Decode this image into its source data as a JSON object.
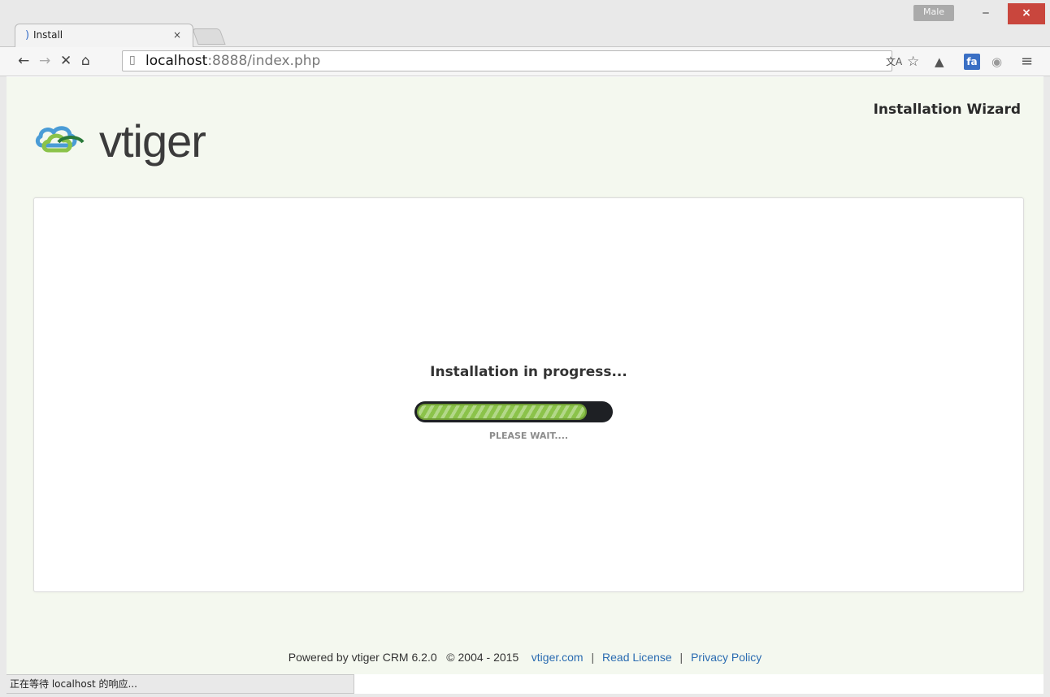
{
  "browser": {
    "tab_title": "Install",
    "tab_close": "×",
    "user_badge": "Male",
    "url_host": "localhost",
    "url_path": ":8888/index.php",
    "window": {
      "minimize": "‒",
      "maximize": "☐",
      "close": "×"
    },
    "nav": {
      "back": "←",
      "forward": "→",
      "stop": "✕",
      "home": "⌂"
    },
    "menu_icon": "≡",
    "fa_icon": "fa"
  },
  "page": {
    "header": {
      "title": "Installation Wizard"
    },
    "logo": {
      "text": "vtiger"
    },
    "progress": {
      "title": "Installation in progress...",
      "subtitle": "PLEASE WAIT....",
      "fraction": 0.88
    },
    "footer": {
      "powered_by": "Powered by vtiger CRM 6.2.0",
      "copyright": "© 2004 - 2015",
      "link_site": "vtiger.com",
      "link_license": "Read License",
      "link_privacy": "Privacy Policy",
      "separator": "|"
    }
  },
  "statusbar": {
    "text": "正在等待 localhost 的响应..."
  },
  "colors": {
    "page_bg": "#f4f8ef",
    "progress_fill": "#8bc34a",
    "progress_track": "#1e2024",
    "link": "#2a6bb1",
    "close_button": "#c9463d"
  }
}
